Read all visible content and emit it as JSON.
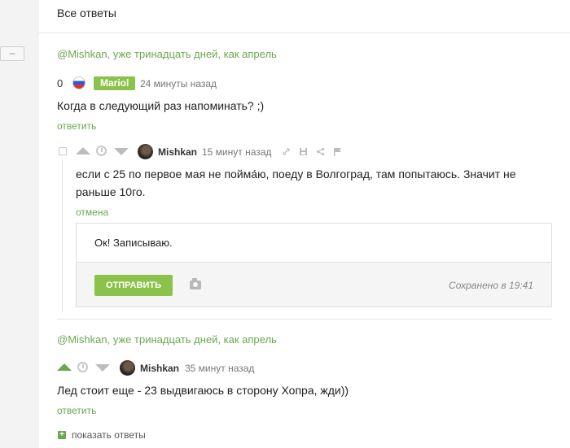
{
  "sidebar": {
    "collapse_label": "–"
  },
  "header": {
    "all_answers": "Все ответы"
  },
  "thread1": {
    "title": "@Mishkan, уже тринадцать дней, как апрель",
    "comment": {
      "rating": "0",
      "author_tag": "Mariol",
      "time": "24 минуты назад",
      "text": "Когда в следующий раз напоминать? ;)",
      "reply_link": "ответить"
    },
    "reply": {
      "author": "Mishkan",
      "time": "15 минут назад",
      "text": "если с 25 по первое мая не пойма́ю, поеду в Волгоград, там попытаюсь. Значит не раньше 10го.",
      "cancel_link": "отмена"
    },
    "reply_form": {
      "text": "Ок! Записываю.",
      "send_label": "ОТПРАВИТЬ",
      "saved_status": "Сохранено в 19:41"
    }
  },
  "thread2": {
    "title": "@Mishkan, уже тринадцать дней, как апрель",
    "comment": {
      "author": "Mishkan",
      "time": "35 минут назад",
      "text": "Лед стоит еще - 23 выдвигаюсь в сторону Хопра, жди))",
      "reply_link": "ответить",
      "show_answers": "показать ответы"
    }
  },
  "icons": {
    "upvote": "triangle-up",
    "downvote": "triangle-down",
    "clock": "clock",
    "link": "link",
    "save": "floppy",
    "share": "share",
    "flag": "flag",
    "camera": "camera",
    "plus": "plus"
  },
  "colors": {
    "accent": "#6aa84f",
    "button": "#8bc34a"
  }
}
